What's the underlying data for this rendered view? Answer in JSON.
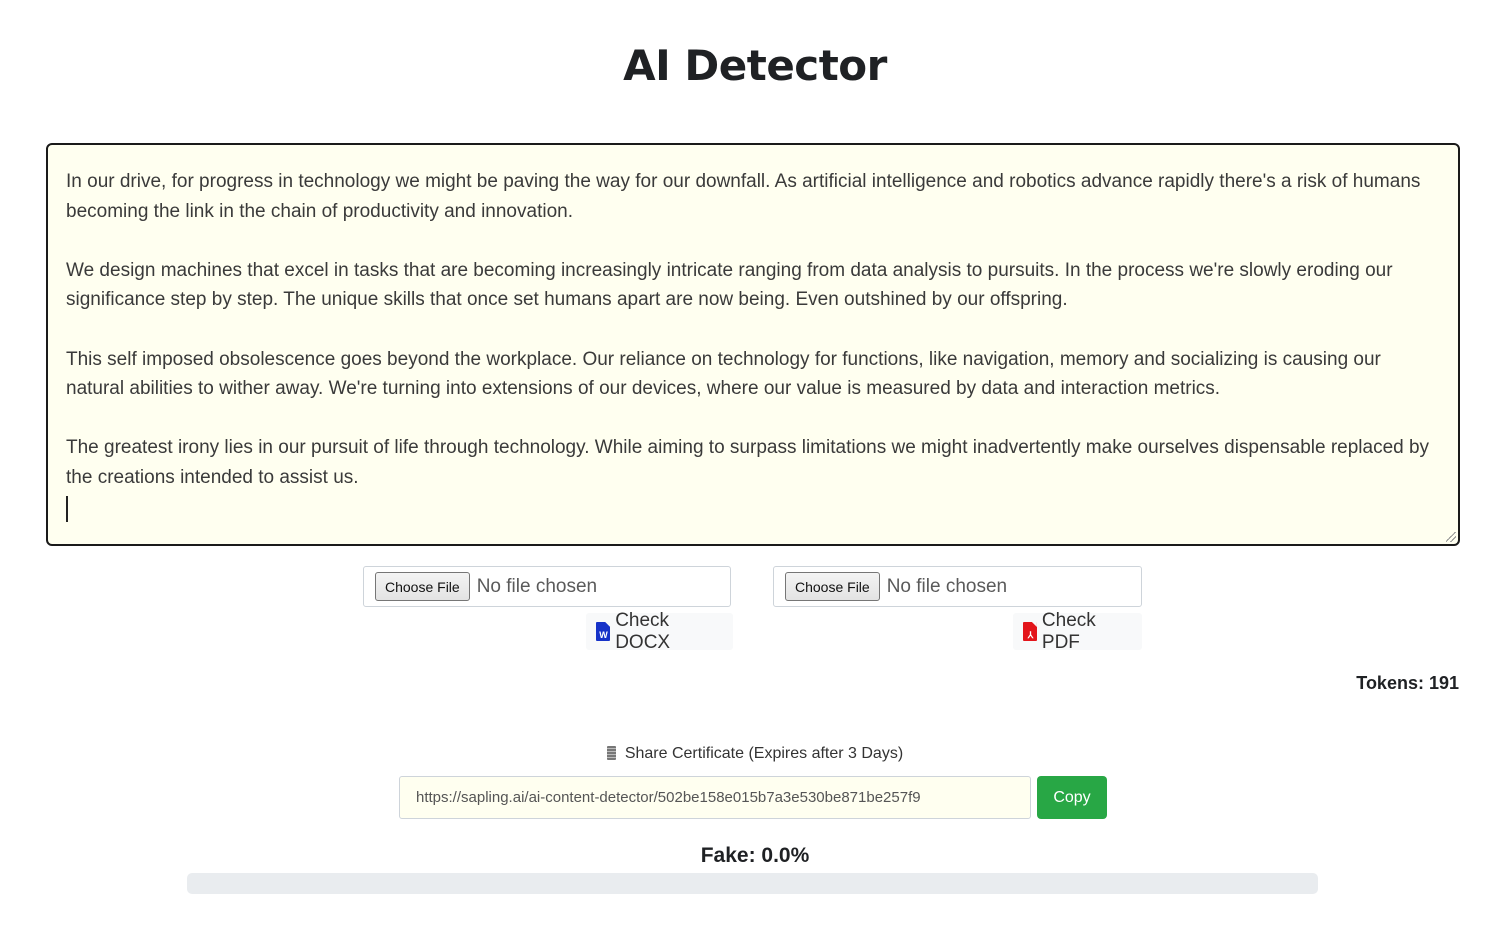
{
  "page": {
    "title": "AI Detector"
  },
  "editor": {
    "paragraphs": [
      "In our drive, for progress in technology we might be paving the way for our downfall. As artificial intelligence and robotics advance rapidly there's a risk of humans becoming the link in the chain of productivity and innovation.",
      "We design machines that excel in tasks that are becoming increasingly intricate ranging from data analysis to pursuits. In the process we're slowly eroding our significance step by step. The unique skills that once set humans apart are now being. Even outshined by our offspring.",
      "This self imposed obsolescence goes beyond the workplace. Our reliance on technology for functions, like navigation, memory and socializing is causing our natural abilities to wither away. We're turning into extensions of our devices, where our value is measured by data and interaction metrics.",
      "The greatest irony lies in our pursuit of life through technology. While aiming to surpass limitations we might inadvertently make ourselves dispensable replaced by the creations intended to assist us."
    ]
  },
  "uploads": {
    "docx": {
      "choose_label": "Choose File",
      "status": "No file chosen",
      "check_label": "Check DOCX",
      "icon": "word-file-icon",
      "icon_color": "#1632c8",
      "icon_letter": "W"
    },
    "pdf": {
      "choose_label": "Choose File",
      "status": "No file chosen",
      "check_label": "Check PDF",
      "icon": "pdf-file-icon",
      "icon_color": "#e3151b",
      "icon_letter": "⅄"
    }
  },
  "tokens": {
    "text": "Tokens: 191"
  },
  "share": {
    "icon": "certificate-icon",
    "label": "Share Certificate (Expires after 3 Days)",
    "url": "https://sapling.ai/ai-content-detector/502be158e015b7a3e530be871be257f9",
    "copy_label": "Copy",
    "copy_color": "#28a745"
  },
  "result": {
    "label": "Fake: 0.0%",
    "fake_fraction": 0.0,
    "bar_color": "#dc3545"
  }
}
